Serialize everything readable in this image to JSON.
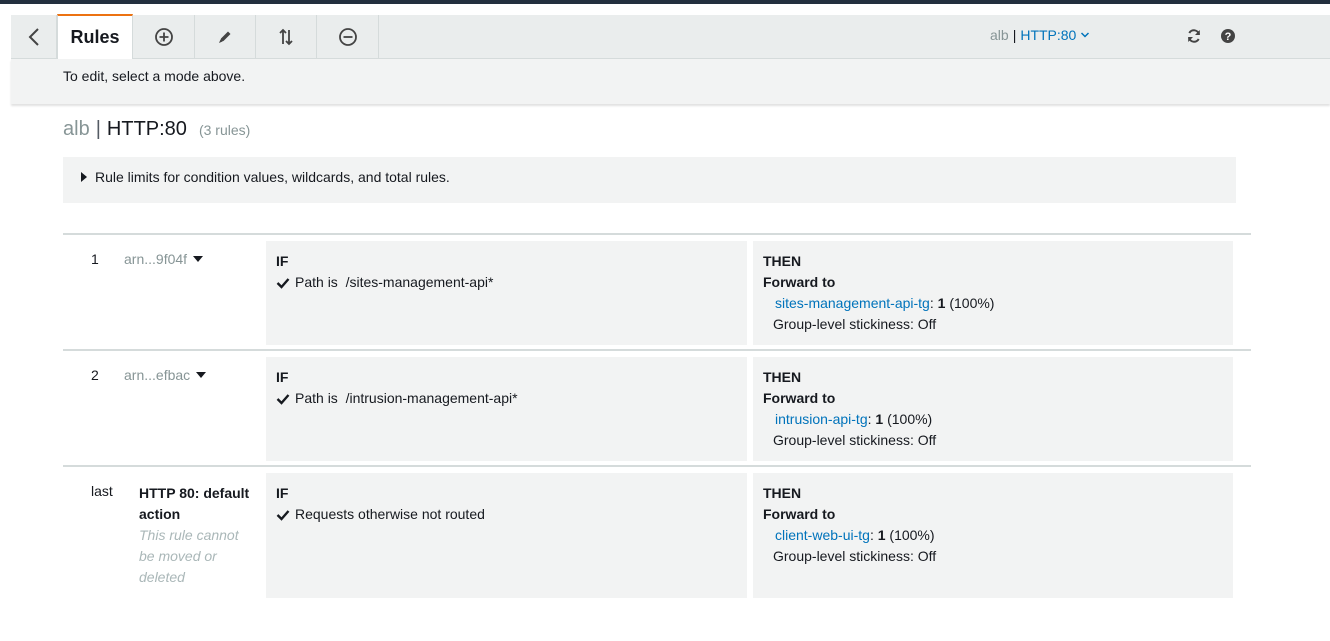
{
  "toolbar": {
    "tabs": {
      "rules": "Rules"
    },
    "listener_prefix": "alb",
    "listener_sep": "|",
    "listener_selected": "HTTP:80",
    "icons": [
      "chevron-left-icon",
      "plus-circle-icon",
      "pencil-icon",
      "reorder-arrows-icon",
      "minus-circle-icon",
      "chevron-down-icon",
      "refresh-icon",
      "help-icon"
    ]
  },
  "hint": "To edit, select a mode above.",
  "heading": {
    "lb": "alb",
    "sep": "|",
    "listener": "HTTP:80",
    "count": "(3 rules)"
  },
  "limits": {
    "label": "Rule limits for condition values, wildcards, and total rules."
  },
  "rules": [
    {
      "num": "1",
      "arn": "arn...9f04f",
      "if_label": "IF",
      "condition": "Path is  /sites-management-api*",
      "then_label": "THEN",
      "forward": "Forward to",
      "target": "sites-management-api-tg",
      "colon": ":",
      "weight": "1",
      "pct": "(100%)",
      "stickiness": "Group-level stickiness: Off"
    },
    {
      "num": "2",
      "arn": "arn...efbac",
      "if_label": "IF",
      "condition": "Path is  /intrusion-management-api*",
      "then_label": "THEN",
      "forward": "Forward to",
      "target": "intrusion-api-tg",
      "colon": ":",
      "weight": "1",
      "pct": "(100%)",
      "stickiness": "Group-level stickiness: Off"
    },
    {
      "num": "last",
      "name": "HTTP 80: default action",
      "note": "This rule cannot be moved or deleted",
      "if_label": "IF",
      "condition": "Requests otherwise not routed",
      "then_label": "THEN",
      "forward": "Forward to",
      "target": "client-web-ui-tg",
      "colon": ":",
      "weight": "1",
      "pct": "(100%)",
      "stickiness": "Group-level stickiness: Off"
    }
  ],
  "colors": {
    "accent": "#ec7211",
    "link": "#0073bb",
    "panel": "#f2f3f3",
    "toolbar": "#eaeded"
  }
}
